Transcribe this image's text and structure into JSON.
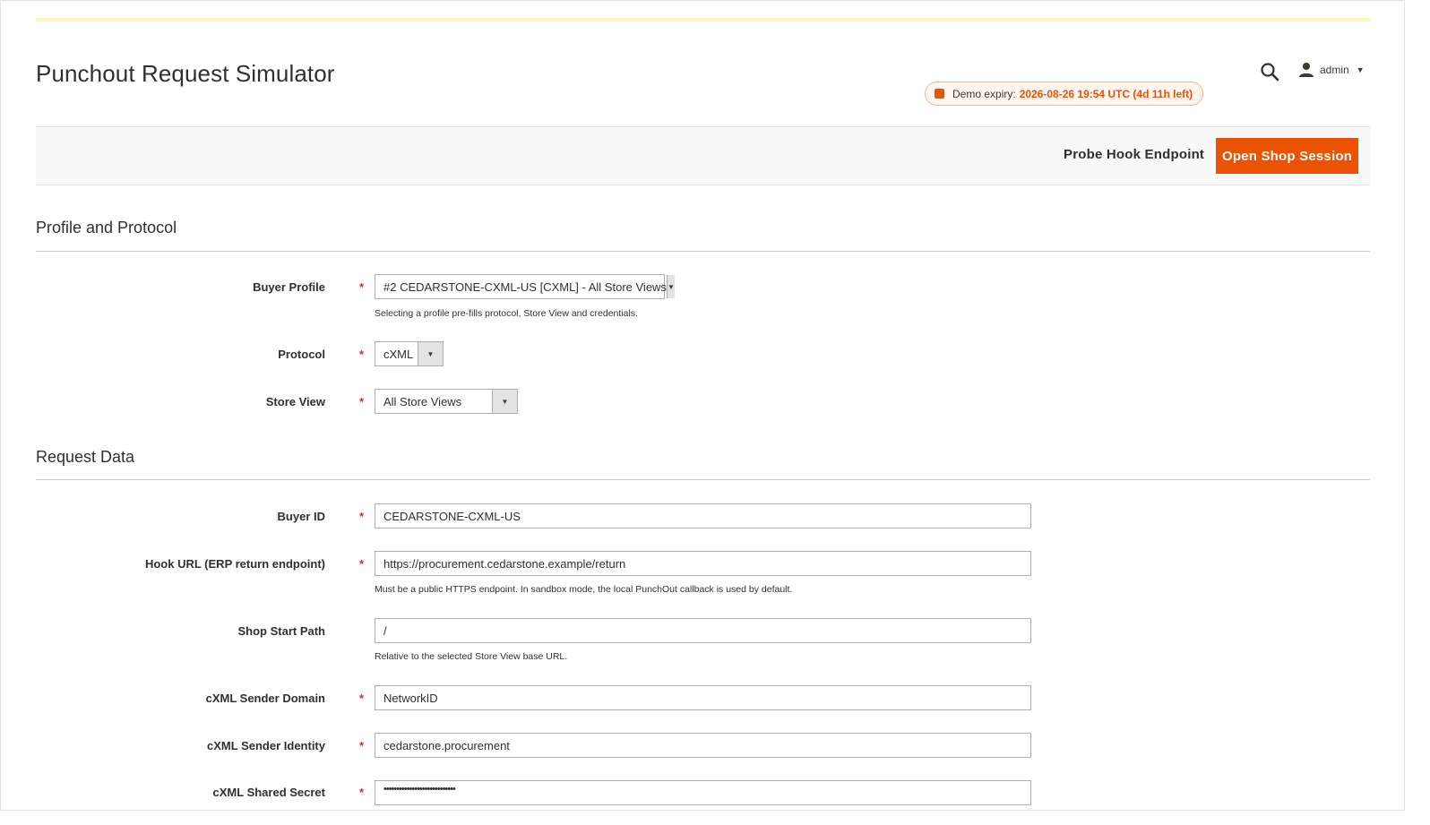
{
  "header": {
    "page_title": "Punchout Request Simulator",
    "user_name": "admin",
    "demo_label": "Demo expiry:",
    "demo_value": "2026-08-26 19:54 UTC (4d 11h left)"
  },
  "toolbar": {
    "probe_label": "Probe Hook Endpoint",
    "open_label": "Open Shop Session"
  },
  "sections": {
    "profile": {
      "title": "Profile and Protocol",
      "buyer_profile": {
        "label": "Buyer Profile",
        "value": "#2 CEDARSTONE-CXML-US [CXML] - All Store Views",
        "note": "Selecting a profile pre-fills protocol, Store View and credentials."
      },
      "protocol": {
        "label": "Protocol",
        "value": "cXML"
      },
      "store_view": {
        "label": "Store View",
        "value": "All Store Views"
      }
    },
    "request": {
      "title": "Request Data",
      "buyer_id": {
        "label": "Buyer ID",
        "value": "CEDARSTONE-CXML-US"
      },
      "hook_url": {
        "label": "Hook URL (ERP return endpoint)",
        "value": "https://procurement.cedarstone.example/return",
        "note": "Must be a public HTTPS endpoint. In sandbox mode, the local PunchOut callback is used by default."
      },
      "shop_start_path": {
        "label": "Shop Start Path",
        "value": "/",
        "note": "Relative to the selected Store View base URL."
      },
      "sender_domain": {
        "label": "cXML Sender Domain",
        "value": "NetworkID"
      },
      "sender_identity": {
        "label": "cXML Sender Identity",
        "value": "cedarstone.procurement"
      },
      "shared_secret": {
        "label": "cXML Shared Secret",
        "value": "••••••••••••••••••••••••••••"
      }
    }
  },
  "required_mark": "*",
  "colors": {
    "accent": "#eb5202",
    "required": "#e22626",
    "border": "#adadad"
  },
  "icons": {
    "search": "search-icon",
    "user": "user-icon",
    "dropdown": "chevron-down-icon"
  }
}
